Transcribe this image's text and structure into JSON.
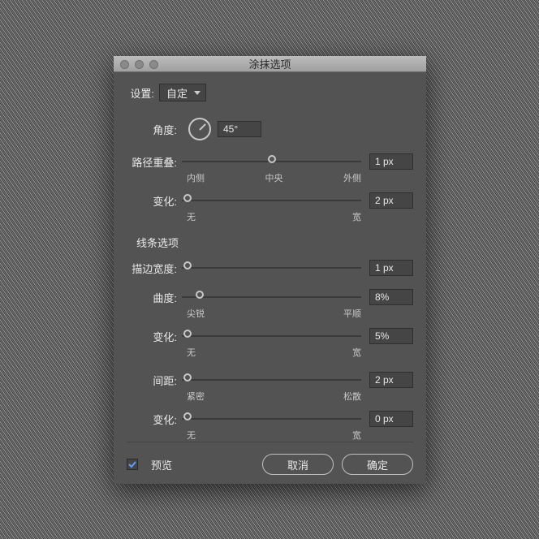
{
  "title": "涂抹选项",
  "settings_label": "设置:",
  "settings_value": "自定",
  "angle": {
    "label": "角度:",
    "value": "45°"
  },
  "path_overlap": {
    "label": "路径重叠:",
    "value": "1 px",
    "left": "内侧",
    "center": "中央",
    "right": "外侧",
    "pos": 50
  },
  "path_variation": {
    "label": "变化:",
    "value": "2 px",
    "left": "无",
    "right": "宽",
    "pos": 3
  },
  "line_section": "线条选项",
  "stroke_width": {
    "label": "描边宽度:",
    "value": "1 px",
    "pos": 3
  },
  "curvature": {
    "label": "曲度:",
    "value": "8%",
    "left": "尖锐",
    "right": "平顺",
    "pos": 10
  },
  "curv_variation": {
    "label": "变化:",
    "value": "5%",
    "left": "无",
    "right": "宽",
    "pos": 3
  },
  "spacing": {
    "label": "间距:",
    "value": "2 px",
    "left": "紧密",
    "right": "松散",
    "pos": 3
  },
  "spacing_variation": {
    "label": "变化:",
    "value": "0 px",
    "left": "无",
    "right": "宽",
    "pos": 3
  },
  "preview": "预览",
  "cancel": "取消",
  "ok": "确定"
}
